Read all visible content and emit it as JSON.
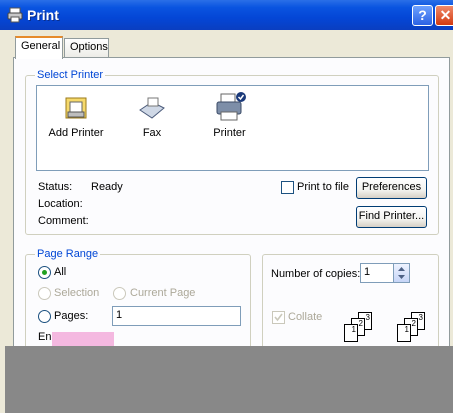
{
  "window": {
    "title": "Print"
  },
  "tabs": [
    {
      "label": "General"
    },
    {
      "label": "Options"
    }
  ],
  "select_printer": {
    "legend": "Select Printer",
    "printers": [
      {
        "label": "Add Printer",
        "icon": "add-printer-icon"
      },
      {
        "label": "Fax",
        "icon": "fax-icon"
      },
      {
        "label": "Printer",
        "icon": "printer-icon"
      }
    ],
    "status_label": "Status:",
    "status_value": "Ready",
    "location_label": "Location:",
    "comment_label": "Comment:",
    "print_to_file_label": "Print to file",
    "preferences_label": "Preferences",
    "find_printer_label": "Find Printer..."
  },
  "page_range": {
    "legend": "Page Range",
    "all_label": "All",
    "selection_label": "Selection",
    "current_page_label": "Current Page",
    "pages_label": "Pages:",
    "pages_value": "1",
    "enter_text": "En"
  },
  "copies": {
    "number_label": "Number of copies:",
    "number_value": "1",
    "collate_label": "Collate",
    "page_labels": [
      "1",
      "2",
      "3",
      "1",
      "2",
      "3"
    ]
  }
}
